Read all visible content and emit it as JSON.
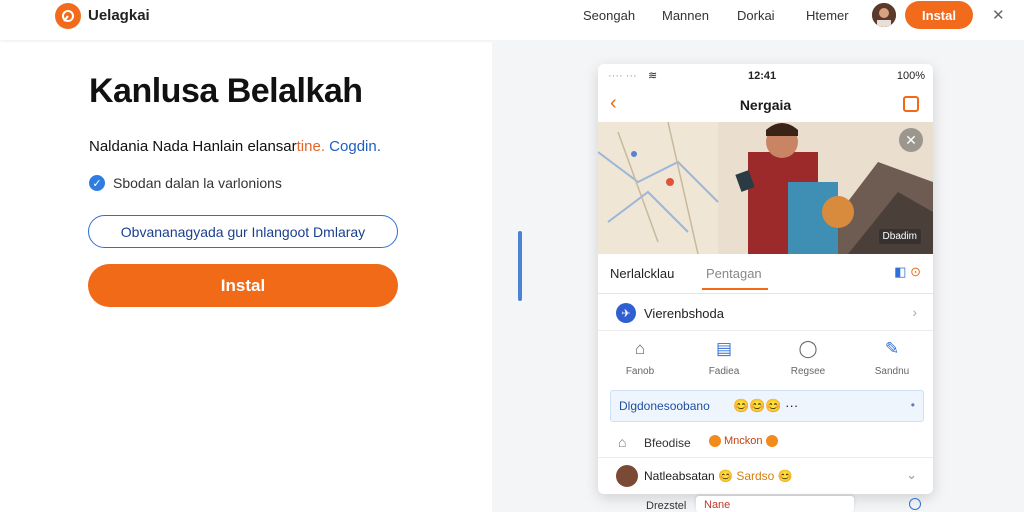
{
  "nav": {
    "brand": "Uelagkai",
    "links": [
      "Seongah",
      "Mannen",
      "Dorkai",
      "Htemer"
    ],
    "install_label": "Instal",
    "close_glyph": "✕"
  },
  "hero": {
    "title": "Kanlusa Belalkah",
    "subtitle_main": "Naldania Nada Hanlain elansar",
    "subtitle_orange": "tine.",
    "subtitle_blue": "Cogdin.",
    "check_text": "Sbodan dalan la varlonions",
    "outline_button": "Obvananagyada gur Inlangoot Dmlaray",
    "install_button": "Instal"
  },
  "phone": {
    "status_left": "···· ··· ",
    "status_time": "12:41",
    "status_right": "100%",
    "title": "Nergaia",
    "image_badge": "Dbadim",
    "tab_1": "Nerlalcklau",
    "tab_2": "Pentagan",
    "profile_label": "Vierenbshoda",
    "grid": [
      {
        "icon": "home-icon",
        "glyph": "⌂",
        "label": "Fanob"
      },
      {
        "icon": "card-icon",
        "glyph": "▤",
        "label": "Fadiea"
      },
      {
        "icon": "chat-icon",
        "glyph": "◯",
        "label": "Regsee"
      },
      {
        "icon": "pen-icon",
        "glyph": "✎",
        "label": "Sandnu"
      }
    ],
    "input_text": "Dlgdonesoobano",
    "input_emoji": "😊😊😊 ···",
    "react_label": "Bfeodise",
    "react_badge": "Mnckon",
    "comment_label": "Natleabsatan",
    "comment_gold": "😊 Sardso 😊",
    "bottom_label": "Drezstel",
    "bottom_pill": "Nane"
  },
  "colors": {
    "accent": "#f06a17",
    "link_blue": "#2f6fd6"
  }
}
